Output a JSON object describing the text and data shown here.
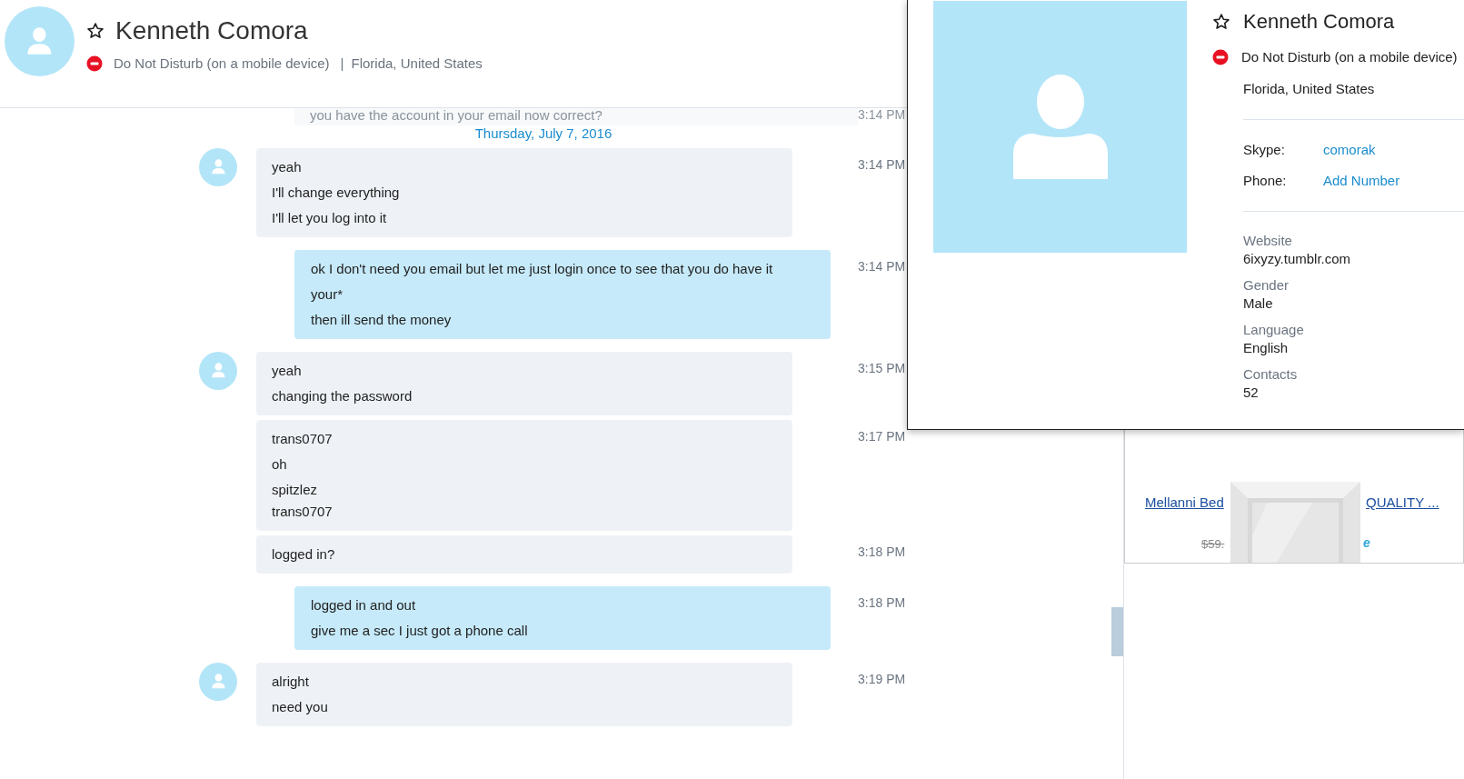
{
  "contact": {
    "name": "Kenneth Comora",
    "favorite": false,
    "status": "Do Not Disturb (on a mobile device)",
    "separator": "|",
    "location": "Florida, United States"
  },
  "chat": {
    "faded_message": {
      "text": "you have the account in your email now correct?",
      "time": "3:14 PM"
    },
    "date": "Thursday, July 7, 2016",
    "messages": [
      {
        "kind": "received",
        "avatar": true,
        "time": "3:14 PM",
        "lines": [
          "yeah",
          "I'll change everything",
          "I'll let you log into it"
        ]
      },
      {
        "kind": "sent",
        "avatar": false,
        "time": "3:14 PM",
        "lines": [
          "ok I don't need you email but let me just login once to see that you do have it",
          "your*",
          "then ill send the money"
        ]
      },
      {
        "kind": "received",
        "avatar": true,
        "time": "3:15 PM",
        "lines": [
          "yeah",
          "changing the password"
        ]
      },
      {
        "kind": "received",
        "avatar": false,
        "time": "3:17 PM",
        "lines": [
          "trans0707",
          "oh",
          "spitzlez\ntrans0707"
        ]
      },
      {
        "kind": "received",
        "avatar": false,
        "time": "3:18 PM",
        "lines": [
          "logged in?"
        ]
      },
      {
        "kind": "sent",
        "avatar": false,
        "time": "3:18 PM",
        "lines": [
          "logged in and out",
          "give me a sec I just got a phone call"
        ]
      },
      {
        "kind": "received",
        "avatar": true,
        "time": "3:19 PM",
        "lines": [
          "alright",
          "need you"
        ]
      }
    ]
  },
  "profile_card": {
    "name": "Kenneth Comora",
    "favorite": false,
    "status": "Do Not Disturb (on a mobile device)",
    "location": "Florida, United States",
    "fields": [
      {
        "label": "Skype:",
        "value": "comorak",
        "kind": "link"
      },
      {
        "label": "Phone:",
        "value": "Add Number",
        "kind": "link"
      }
    ],
    "details": [
      {
        "label": "Website",
        "value": "6ixyzy.tumblr.com"
      },
      {
        "label": "Gender",
        "value": "Male"
      },
      {
        "label": "Language",
        "value": "English"
      },
      {
        "label": "Contacts",
        "value": "52"
      }
    ]
  },
  "ad": {
    "title_left": "Mellanni Bed",
    "title_right": "QUALITY ...",
    "old_price": "$59.",
    "logo_fragment": "e"
  }
}
